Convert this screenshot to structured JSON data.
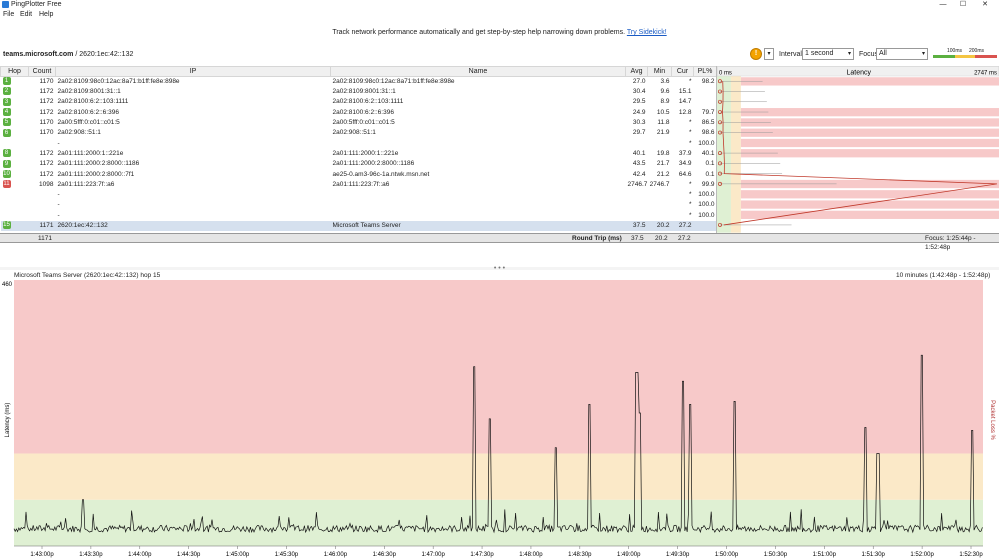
{
  "window": {
    "title": "PingPlotter Free",
    "minimize": "—",
    "maximize": "☐",
    "close": "✕"
  },
  "menu": [
    "File",
    "Edit",
    "Help"
  ],
  "promo": {
    "text": "Track network performance automatically and get step-by-step help narrowing down problems.",
    "link": "Try Sidekick!"
  },
  "target": {
    "host": "teams.microsoft.com",
    "ip": " / 2620:1ec:42::132"
  },
  "toolbar": {
    "hint_icon": "!",
    "interval_label": "Interval",
    "interval_value": "1 second",
    "focus_label": "Focus",
    "focus_value": "All",
    "scale_100": "100ms",
    "scale_200": "200ms"
  },
  "colors": {
    "good": "#5bb040",
    "bad": "#d9534f",
    "red_zone": "#f7c9c9",
    "yellow_zone": "#fbe9c8",
    "green_zone": "#dff0d3"
  },
  "table": {
    "headers": [
      "Hop",
      "Count",
      "IP",
      "Name",
      "Avg",
      "Min",
      "Cur",
      "PL%"
    ],
    "rows": [
      {
        "hop": "1",
        "status": "g",
        "count": "1170",
        "ip": "2a02:8109:98c0:12ac:8a71:b1ff:fe8e:898e",
        "name": "2a02:8109:98c0:12ac:8a71:b1ff:fe8e:898e",
        "avg": "27.0",
        "min": "3.6",
        "cur": "*",
        "pl": "98.2"
      },
      {
        "hop": "2",
        "status": "g",
        "count": "1172",
        "ip": "2a02:8109:8001:31::1",
        "name": "2a02:8109:8001:31::1",
        "avg": "30.4",
        "min": "9.6",
        "cur": "15.1",
        "pl": ""
      },
      {
        "hop": "3",
        "status": "g",
        "count": "1172",
        "ip": "2a02:8100:6:2::103:1111",
        "name": "2a02:8100:6:2::103:1111",
        "avg": "29.5",
        "min": "8.9",
        "cur": "14.7",
        "pl": ""
      },
      {
        "hop": "4",
        "status": "g",
        "count": "1172",
        "ip": "2a02:8100:6:2::6:396",
        "name": "2a02:8100:6:2::6:396",
        "avg": "24.9",
        "min": "10.5",
        "cur": "12.8",
        "pl": "79.7"
      },
      {
        "hop": "5",
        "status": "g",
        "count": "1170",
        "ip": "2a00:5fff:0:c01::c01:5",
        "name": "2a00:5fff:0:c01::c01:5",
        "avg": "30.3",
        "min": "11.8",
        "cur": "*",
        "pl": "86.5"
      },
      {
        "hop": "6",
        "status": "g",
        "count": "1170",
        "ip": "2a02:908::51:1",
        "name": "2a02:908::51:1",
        "avg": "29.7",
        "min": "21.9",
        "cur": "*",
        "pl": "98.6"
      },
      {
        "hop": "",
        "status": "",
        "count": "",
        "ip": "-",
        "name": "",
        "avg": "",
        "min": "",
        "cur": "*",
        "pl": "100.0"
      },
      {
        "hop": "8",
        "status": "g",
        "count": "1172",
        "ip": "2a01:111:2000:1::221e",
        "name": "2a01:111:2000:1::221e",
        "avg": "40.1",
        "min": "19.8",
        "cur": "37.9",
        "pl": "40.1"
      },
      {
        "hop": "9",
        "status": "g",
        "count": "1172",
        "ip": "2a01:111:2000:2:8000::1186",
        "name": "2a01:111:2000:2:8000::1186",
        "avg": "43.5",
        "min": "21.7",
        "cur": "34.9",
        "pl": "0.1"
      },
      {
        "hop": "10",
        "status": "g",
        "count": "1172",
        "ip": "2a01:111:2000:2:8000::7f1",
        "name": "ae25-0.am3-96c-1a.ntwk.msn.net",
        "avg": "42.4",
        "min": "21.2",
        "cur": "64.6",
        "pl": "0.1"
      },
      {
        "hop": "11",
        "status": "r",
        "count": "1098",
        "ip": "2a01:111:223:7f::a6",
        "name": "2a01:111:223:7f::a6",
        "avg": "2746.7",
        "min": "2746.7",
        "cur": "*",
        "pl": "99.9"
      },
      {
        "hop": "",
        "status": "",
        "count": "",
        "ip": "-",
        "name": "",
        "avg": "",
        "min": "",
        "cur": "*",
        "pl": "100.0"
      },
      {
        "hop": "",
        "status": "",
        "count": "",
        "ip": "-",
        "name": "",
        "avg": "",
        "min": "",
        "cur": "*",
        "pl": "100.0"
      },
      {
        "hop": "",
        "status": "",
        "count": "",
        "ip": "-",
        "name": "",
        "avg": "",
        "min": "",
        "cur": "*",
        "pl": "100.0"
      },
      {
        "hop": "15",
        "status": "g",
        "count": "1171",
        "ip": "2620:1ec:42::132",
        "name": "Microsoft Teams Server",
        "avg": "37.5",
        "min": "20.2",
        "cur": "27.2",
        "pl": ""
      }
    ],
    "summary": {
      "count": "1171",
      "label": "Round Trip (ms)",
      "avg": "37.5",
      "min": "20.2",
      "cur": "27.2",
      "focus": "Focus: 1:25:44p - 1:52:48p"
    }
  },
  "latency_panel": {
    "header": "Latency",
    "left_label": "0 ms",
    "right_label": "2747 ms"
  },
  "graph": {
    "header": "Microsoft Teams Server (2620:1ec:42::132) hop 15",
    "range": "10 minutes (1:42:48p - 1:52:48p)",
    "ylabel": "Latency (ms)",
    "y2label": "Packet Loss %"
  },
  "chart_data": {
    "type": "line",
    "title": "",
    "ylabel": "Latency (ms)",
    "ylim": [
      0,
      460
    ],
    "ytick_top": "460",
    "x_ticks": [
      "1:43:00p",
      "1:43:30p",
      "1:44:00p",
      "1:44:30p",
      "1:45:00p",
      "1:45:30p",
      "1:46:00p",
      "1:46:30p",
      "1:47:00p",
      "1:47:30p",
      "1:48:00p",
      "1:48:30p",
      "1:49:00p",
      "1:49:30p",
      "1:50:00p",
      "1:50:30p",
      "1:51:00p",
      "1:51:30p",
      "1:52:00p",
      "1:52:30p"
    ],
    "zones": [
      {
        "from": 0,
        "to": 80,
        "color": "#dff0d3"
      },
      {
        "from": 80,
        "to": 160,
        "color": "#fbe9c8"
      },
      {
        "from": 160,
        "to": 460,
        "color": "#f7c9c9"
      }
    ],
    "spikes": [
      {
        "t": "1:43:25p",
        "v": 80
      },
      {
        "t": "1:47:25p",
        "v": 310
      },
      {
        "t": "1:47:35p",
        "v": 220
      },
      {
        "t": "1:48:15p",
        "v": 170
      },
      {
        "t": "1:48:36p",
        "v": 245
      },
      {
        "t": "1:49:05p",
        "v": 300
      },
      {
        "t": "1:49:07p",
        "v": 230
      },
      {
        "t": "1:49:33p",
        "v": 285
      },
      {
        "t": "1:49:38p",
        "v": 245
      },
      {
        "t": "1:50:05p",
        "v": 250
      },
      {
        "t": "1:51:25p",
        "v": 205
      },
      {
        "t": "1:51:33p",
        "v": 160
      },
      {
        "t": "1:52:00p",
        "v": 330
      },
      {
        "t": "1:52:31p",
        "v": 200
      }
    ],
    "baseline": 30
  }
}
